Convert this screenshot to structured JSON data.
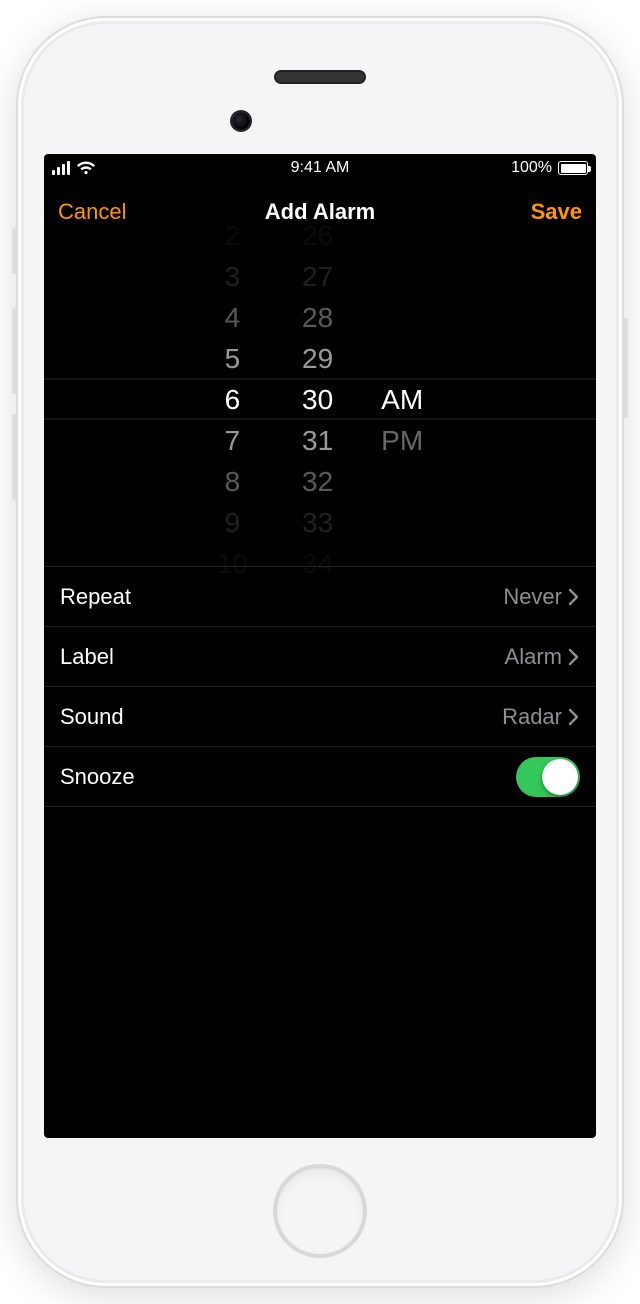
{
  "status": {
    "time": "9:41 AM",
    "battery_pct": "100%"
  },
  "navbar": {
    "cancel": "Cancel",
    "title": "Add Alarm",
    "save": "Save"
  },
  "picker": {
    "hours": {
      "m4": "2",
      "m3": "3",
      "m2": "4",
      "m1": "5",
      "sel": "6",
      "p1": "7",
      "p2": "8",
      "p3": "9",
      "p4": "10"
    },
    "minutes": {
      "m4": "26",
      "m3": "27",
      "m2": "28",
      "m1": "29",
      "sel": "30",
      "p1": "31",
      "p2": "32",
      "p3": "33",
      "p4": "34"
    },
    "meridiem": {
      "sel": "AM",
      "other": "PM"
    }
  },
  "rows": {
    "repeat": {
      "label": "Repeat",
      "value": "Never"
    },
    "label": {
      "label": "Label",
      "value": "Alarm"
    },
    "sound": {
      "label": "Sound",
      "value": "Radar"
    },
    "snooze": {
      "label": "Snooze",
      "on": true
    }
  }
}
